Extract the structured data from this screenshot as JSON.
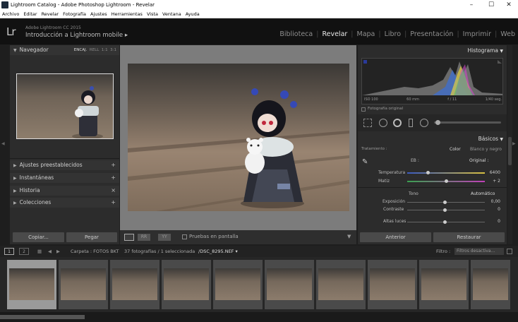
{
  "window": {
    "title": "Lightroom Catalog - Adobe Photoshop Lightroom - Revelar"
  },
  "menu": [
    "Archivo",
    "Editar",
    "Revelar",
    "Fotografía",
    "Ajustes",
    "Herramientas",
    "Vista",
    "Ventana",
    "Ayuda"
  ],
  "identity": {
    "logo": "Lr",
    "version": "Adobe Lightroom CC 2015",
    "mobile": "Introducción a Lightroom mobile ▸"
  },
  "modules": [
    "Biblioteca",
    "Revelar",
    "Mapa",
    "Libro",
    "Presentación",
    "Imprimir",
    "Web"
  ],
  "active_module": "Revelar",
  "left_panel": {
    "navigator": {
      "title": "Navegador",
      "options": [
        "ENCAJ.",
        "RELL",
        "1:1",
        "3:1"
      ]
    },
    "sections": [
      {
        "title": "Ajustes preestablecidos",
        "action": "+"
      },
      {
        "title": "Instantáneas",
        "action": "+"
      },
      {
        "title": "Historia",
        "action": "×"
      },
      {
        "title": "Colecciones",
        "action": "+"
      }
    ],
    "copy_button": "Copiar...",
    "paste_button": "Pegar"
  },
  "toolbar": {
    "view_icon": "□",
    "compare_icon": "RR",
    "survey_icon": "YY",
    "soft_proof_label": "Pruebas en pantalla"
  },
  "right_panel": {
    "histogram": {
      "title": "Histograma",
      "iso": "ISO 100",
      "focal": "60 mm",
      "aperture": "f / 11",
      "shutter": "1/40 seg.",
      "original_label": "Fotografía original"
    },
    "basic": {
      "title": "Básicos",
      "treatment_label": "Tratamiento :",
      "treatment_color": "Color",
      "treatment_bw": "Blanco y negro",
      "wb_label": "EB :",
      "wb_value": "Original :",
      "temp_label": "Temperatura",
      "temp_value": "6400",
      "tint_label": "Matiz",
      "tint_value": "+ 2",
      "tone_label": "Tono",
      "auto_label": "Automático",
      "exposure_label": "Exposición",
      "exposure_value": "0,00",
      "contrast_label": "Contraste",
      "contrast_value": "0",
      "highlights_label": "Altas luces",
      "highlights_value": "0"
    },
    "prev_button": "Anterior",
    "reset_button": "Restaurar"
  },
  "filmbar": {
    "view1": "1",
    "view2": "2",
    "source": "Carpeta : FOTOS BKT",
    "count": "37 fotografías / 1 seleccionada",
    "filename": "/DSC_8295.NEF ▾",
    "filter_label": "Filtro :",
    "filter_value": "Filtros desactiva..."
  },
  "colors": {
    "accent_active": "#e8e8e8",
    "panel": "#2c2c2c",
    "background": "#1e1e1e"
  }
}
